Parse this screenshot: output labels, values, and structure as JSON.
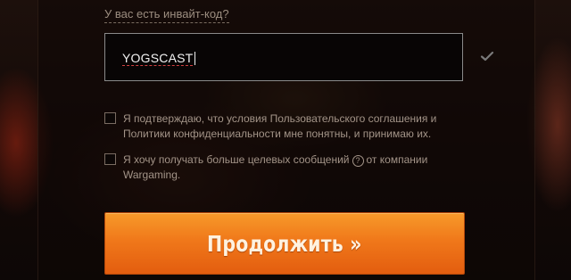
{
  "invite": {
    "label": "У вас есть инвайт-код?",
    "value": "YOGSCAST",
    "status_icon": "check-icon"
  },
  "agreements": {
    "terms_text": "Я подтверждаю, что условия Пользовательского соглашения и Политики конфиденциальности мне понятны, и принимаю их.",
    "terms_checked": false,
    "marketing_text_before": "Я хочу получать больше целевых сообщений",
    "marketing_help_glyph": "?",
    "marketing_text_after": "от компании Wargaming.",
    "marketing_checked": false
  },
  "actions": {
    "continue_label": "Продолжить »"
  },
  "colors": {
    "accent_orange": "#f0781a",
    "muted_text": "#a39488"
  }
}
